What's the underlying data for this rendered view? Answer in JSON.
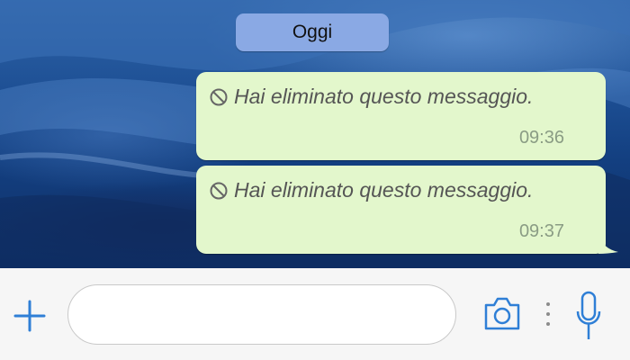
{
  "conversation": {
    "date_separator": "Oggi",
    "messages": [
      {
        "text": "Hai eliminato questo messaggio.",
        "time": "09:36",
        "status_icon": "ban-icon",
        "deleted": true
      },
      {
        "text": "Hai eliminato questo messaggio.",
        "time": "09:37",
        "status_icon": "ban-icon",
        "deleted": true
      }
    ]
  },
  "composer": {
    "value": "",
    "placeholder": "",
    "icons": [
      "plus-icon",
      "camera-icon",
      "more-vertical-icon",
      "microphone-icon"
    ]
  },
  "colors": {
    "bubble": "#e3f7cc",
    "date_pill": "#8aa9e4",
    "accent": "#2f7fd6",
    "composer_bg": "#f6f6f6"
  }
}
